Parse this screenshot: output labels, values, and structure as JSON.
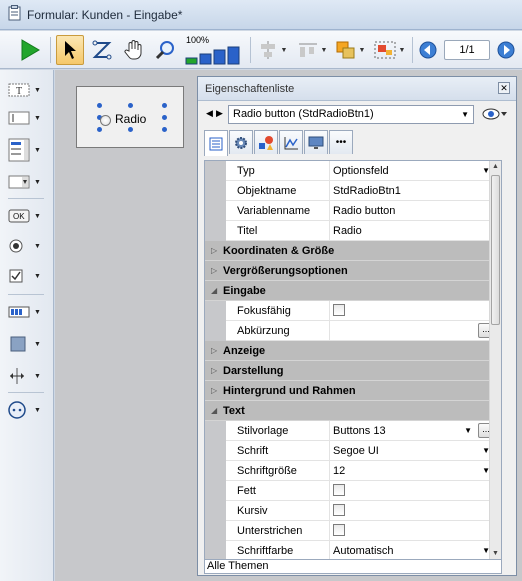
{
  "window": {
    "title": "Formular: Kunden -  Eingabe*"
  },
  "toolbar": {
    "zoom_label": "100%",
    "page_indicator": "1/1",
    "zoom_bar_levels": [
      0.35,
      0.55,
      0.75,
      0.95
    ]
  },
  "canvas": {
    "radio_label": "Radio"
  },
  "properties": {
    "title": "Eigenschaftenliste",
    "close_glyph": "✕",
    "object_selector": "Radio button (StdRadioBtn1)",
    "footer": "Alle Themen",
    "rows": [
      {
        "kind": "prop",
        "name": "Typ",
        "value": "Optionsfeld",
        "dropdown": true
      },
      {
        "kind": "prop",
        "name": "Objektname",
        "value": "StdRadioBtn1"
      },
      {
        "kind": "prop",
        "name": "Variablenname",
        "value": "Radio button"
      },
      {
        "kind": "prop",
        "name": "Titel",
        "value": "Radio"
      },
      {
        "kind": "cat",
        "name": "Koordinaten & Größe",
        "expanded": false
      },
      {
        "kind": "cat",
        "name": "Vergrößerungsoptionen",
        "expanded": false
      },
      {
        "kind": "cat",
        "name": "Eingabe",
        "expanded": true
      },
      {
        "kind": "prop",
        "name": "Fokusfähig",
        "checkbox": true
      },
      {
        "kind": "prop",
        "name": "Abkürzung",
        "value": "",
        "ellipsis": true
      },
      {
        "kind": "cat",
        "name": "Anzeige",
        "expanded": false
      },
      {
        "kind": "cat",
        "name": "Darstellung",
        "expanded": false
      },
      {
        "kind": "cat",
        "name": "Hintergrund und Rahmen",
        "expanded": false
      },
      {
        "kind": "cat",
        "name": "Text",
        "expanded": true
      },
      {
        "kind": "prop",
        "name": "Stilvorlage",
        "value": "Buttons 13",
        "dropdown": true,
        "ellipsis": true
      },
      {
        "kind": "prop",
        "name": "Schrift",
        "value": "Segoe UI",
        "dropdown": true
      },
      {
        "kind": "prop",
        "name": "Schriftgröße",
        "value": "12",
        "dropdown": true
      },
      {
        "kind": "prop",
        "name": "Fett",
        "checkbox": true
      },
      {
        "kind": "prop",
        "name": "Kursiv",
        "checkbox": true
      },
      {
        "kind": "prop",
        "name": "Unterstrichen",
        "checkbox": true
      },
      {
        "kind": "prop",
        "name": "Schriftfarbe",
        "value": "Automatisch",
        "dropdown": true
      }
    ]
  },
  "colors": {
    "accent": "#2a62c9",
    "category_bg": "#bcbcbc",
    "run_green": "#22a52c"
  }
}
